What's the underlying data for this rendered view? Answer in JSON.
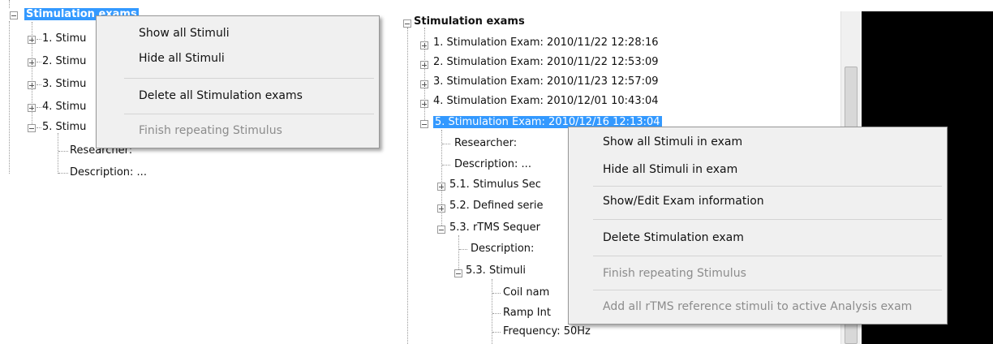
{
  "left_panel": {
    "root_label": "Stimulation exams",
    "exams": [
      {
        "label": "1. Stimu"
      },
      {
        "label": "2. Stimu"
      },
      {
        "label": "3. Stimu"
      },
      {
        "label": "4. Stimu"
      },
      {
        "label": "5. Stimu"
      }
    ],
    "children": [
      {
        "label": "Researcher:"
      },
      {
        "label": "Description: ..."
      }
    ],
    "context_menu": {
      "items": [
        {
          "label": "Show all Stimuli",
          "enabled": true
        },
        {
          "label": "Hide all Stimuli",
          "enabled": true
        },
        {
          "label": "Delete all Stimulation exams",
          "enabled": true
        },
        {
          "label": "Finish repeating Stimulus",
          "enabled": false
        }
      ]
    }
  },
  "right_panel": {
    "root_label": "Stimulation exams",
    "exams": [
      {
        "label": "1. Stimulation Exam: 2010/11/22 12:28:16"
      },
      {
        "label": "2. Stimulation Exam: 2010/11/22 12:53:09"
      },
      {
        "label": "3. Stimulation Exam: 2010/11/23 12:57:09"
      },
      {
        "label": "4. Stimulation Exam: 2010/12/01 10:43:04"
      },
      {
        "label": "5. Stimulation Exam: 2010/12/16 12:13:04"
      }
    ],
    "exam5_children": [
      {
        "label": "Researcher:"
      },
      {
        "label": "Description: ..."
      },
      {
        "label": "5.1. Stimulus Sec"
      },
      {
        "label": "5.2. Defined serie"
      },
      {
        "label": "5.3. rTMS Sequer"
      }
    ],
    "rtms_children": [
      {
        "label": "Description:"
      },
      {
        "label": "5.3. Stimuli"
      }
    ],
    "stimuli_children": [
      {
        "label": "Coil nam"
      },
      {
        "label": "Ramp Int"
      },
      {
        "label": "Frequency: 50Hz"
      }
    ],
    "context_menu": {
      "items": [
        {
          "label": "Show all Stimuli in exam",
          "enabled": true
        },
        {
          "label": "Hide all Stimuli in exam",
          "enabled": true
        },
        {
          "label": "Show/Edit Exam information",
          "enabled": true
        },
        {
          "label": "Delete Stimulation exam",
          "enabled": true
        },
        {
          "label": "Finish repeating Stimulus",
          "enabled": false
        },
        {
          "label": "Add all rTMS reference stimuli to active Analysis exam",
          "enabled": false
        }
      ]
    }
  },
  "colors": {
    "selection": "#3399ff",
    "menu_bg": "#f0f0f0",
    "disabled_text": "#8c8c8c",
    "side_panel": "#000000"
  }
}
